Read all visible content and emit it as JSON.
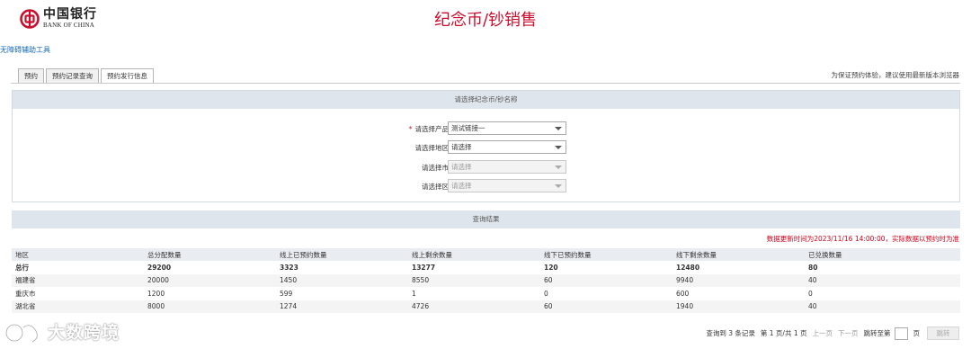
{
  "header": {
    "logo_cn": "中国银行",
    "logo_en": "BANK OF CHINA",
    "title": "纪念币/钞销售"
  },
  "accessibility_link": "无障碍辅助工具",
  "tabs": [
    {
      "label": "预约",
      "active": false
    },
    {
      "label": "预约记录查询",
      "active": false
    },
    {
      "label": "预约发行信息",
      "active": true
    }
  ],
  "browser_note": "为保证预约体验，建议使用最新版本浏览器",
  "selection_panel": {
    "title": "请选择纪念币/钞名称",
    "fields": [
      {
        "label": "请选择产品",
        "required": true,
        "value": "测试链接一",
        "disabled": false
      },
      {
        "label": "请选择地区",
        "required": false,
        "value": "请选择",
        "disabled": false
      },
      {
        "label": "请选择市",
        "required": false,
        "value": "请选择",
        "disabled": true
      },
      {
        "label": "请选择区",
        "required": false,
        "value": "请选择",
        "disabled": true
      }
    ],
    "required_mark": "*"
  },
  "results": {
    "title": "查询结果",
    "update_note": "数据更新时间为2023/11/16 14:00:00，实际数据以预约时为准",
    "columns": [
      "地区",
      "总分配数量",
      "线上已预约数量",
      "线上剩余数量",
      "线下已预约数量",
      "线下剩余数量",
      "已兑换数量"
    ],
    "rows": [
      [
        "总行",
        "29200",
        "3323",
        "13277",
        "120",
        "12480",
        "80"
      ],
      [
        "福建省",
        "20000",
        "1450",
        "8550",
        "60",
        "9940",
        "40"
      ],
      [
        "重庆市",
        "1200",
        "599",
        "1",
        "0",
        "600",
        "0"
      ],
      [
        "湖北省",
        "8000",
        "1274",
        "4726",
        "60",
        "1940",
        "40"
      ]
    ]
  },
  "pager": {
    "total": "查询到 3 条记录",
    "page_info": "第 1 页/共 1 页",
    "prev": "上一页",
    "next": "下一页",
    "jump_label": "跳转至第",
    "page_unit": "页",
    "go": "跳转"
  },
  "watermark": "大数跨境",
  "colors": {
    "brand_red": "#c8102e",
    "panel_header": "#dfe5ec",
    "link_blue": "#1a6bb8",
    "alert_red": "#d0021b"
  }
}
